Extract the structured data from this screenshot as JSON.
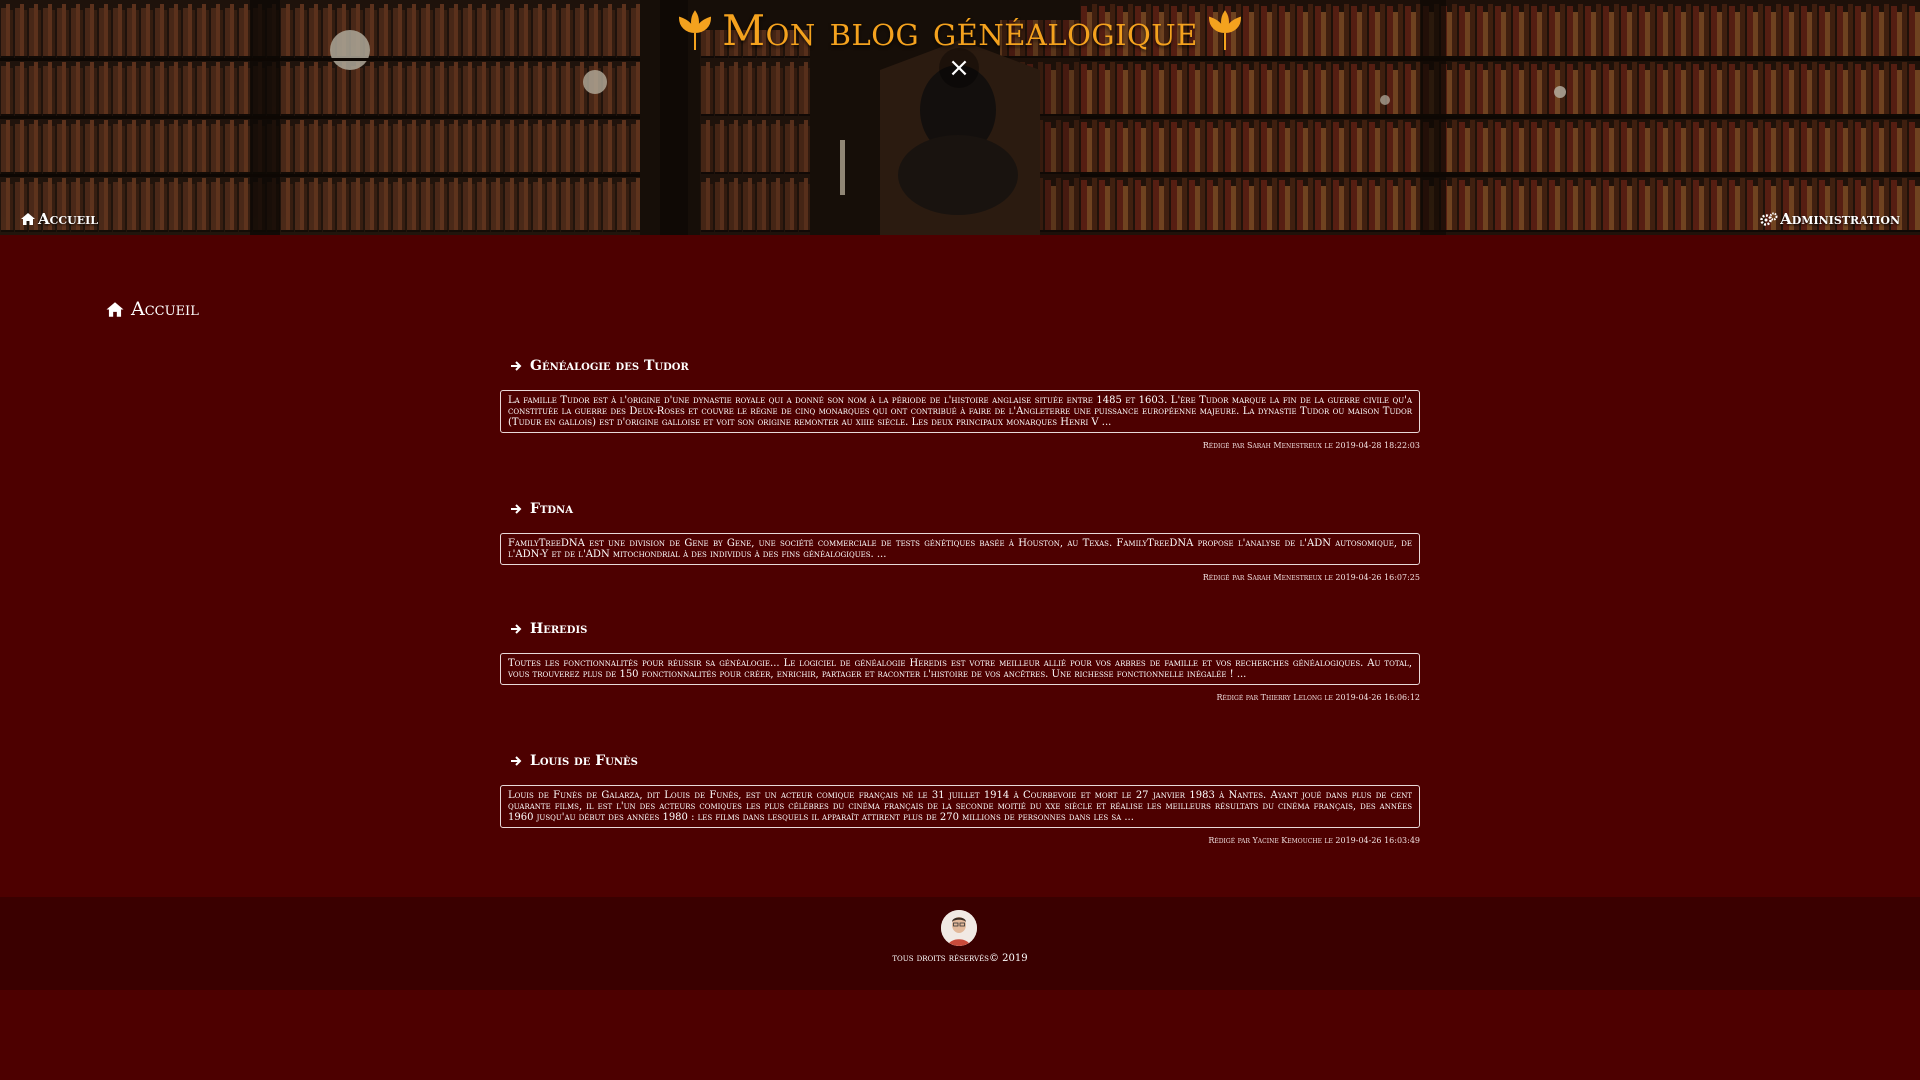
{
  "header": {
    "title": "Mon blog généalogique",
    "close_label": "×",
    "nav": {
      "home_label": "Accueil",
      "admin_label": "Administration"
    }
  },
  "page_heading": "Accueil",
  "posts": [
    {
      "title": "Généalogie des Tudor",
      "excerpt": "La famille Tudor est à l'origine d'une dynastie royale qui a donné son nom à la période de l'histoire anglaise située entre 1485 et 1603. L'ère Tudor marque la fin de la guerre civile qu'a constituée la guerre des Deux-Roses et couvre le règne de cinq monarques qui ont contribué à faire de l'Angleterre une puissance européenne majeure. La dynastie Tudor ou maison Tudor (Tudur en gallois) est d'origine galloise et voit son origine remonter au xiiie siècle. Les deux principaux monarques Henri V ...",
      "meta": "Rédigé par Sarah Menestreux le 2019-04-28 18:22:03"
    },
    {
      "title": "Ftdna",
      "excerpt": "FamilyTreeDNA est une division de Gene by Gene, une société commerciale de tests génétiques basée à Houston, au Texas. FamilyTreeDNA propose l'analyse de l'ADN autosomique, de l'ADN-Y et de l'ADN mitochondrial à des individus à des fins généalogiques. ...",
      "meta": "Rédigé par Sarah Menestreux le 2019-04-26 16:07:25"
    },
    {
      "title": "Heredis",
      "excerpt": "Toutes les fonctionnalités pour réussir sa généalogie... Le logiciel de généalogie Heredis est votre meilleur allié pour vos arbres de famille et vos recherches généalogiques. Au total, vous trouverez plus de 150 fonctionnalités pour créer, enrichir, partager et raconter l'histoire de vos ancêtres. Une richesse fonctionnelle inégalée ! ...",
      "meta": "Rédigé par Thierry Lelong le 2019-04-26 16:06:12"
    },
    {
      "title": "Louis de Funès",
      "excerpt": "Louis de Funès de Galarza, dit Louis de Funès, est un acteur comique français né le 31 juillet 1914 à Courbevoie et mort le 27 janvier 1983 à Nantes. Ayant joué dans plus de cent quarante films, il est l'un des acteurs comiques les plus célèbres du cinéma français de la seconde moitié du xxe siècle et réalise les meilleurs résultats du cinéma français, des années 1960 jusqu'au début des années 1980 : les films dans lesquels il apparaît attirent plus de 270 millions de personnes dans les sa ...",
      "meta": "Rédigé par Yacine Kemouche le 2019-04-26 16:03:49"
    }
  ],
  "footer": {
    "copyright": "tous droits réservés© 2019"
  },
  "colors": {
    "background": "#4d0000",
    "footer": "#3a0000",
    "title_accent": "#f4a21e"
  },
  "icons": [
    "leaf-icon",
    "close-icon",
    "home-icon",
    "gears-icon",
    "arrow-right-icon",
    "avatar"
  ]
}
